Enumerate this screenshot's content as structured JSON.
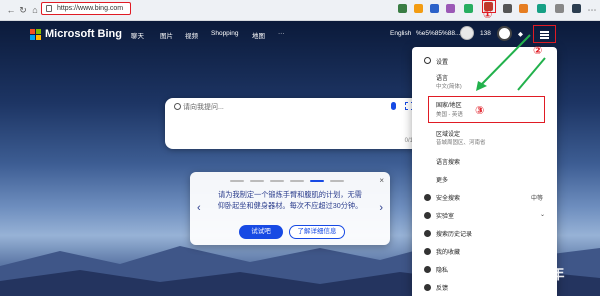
{
  "browser": {
    "url": "https://www.bing.com",
    "icons": [
      "back-icon",
      "reload-icon",
      "home-icon"
    ]
  },
  "annotations": {
    "step1": "①",
    "step2": "②",
    "step3": "③"
  },
  "bing": {
    "logo": "Microsoft Bing",
    "nav": [
      "聊天",
      "图片",
      "视频",
      "Shopping",
      "地图",
      "···"
    ],
    "language_link": "English",
    "account_text": "%e5%85%88...",
    "points": "138",
    "search": {
      "placeholder": "请向我提问...",
      "counter": "0/1000"
    },
    "card": {
      "text": "请为我制定一个锻炼手臂和腹肌的计划，无需仰卧起坐和健身器材。每次不应超过30分钟。",
      "primary_button": "试试吧",
      "secondary_button": "了解详细信息",
      "close": "×",
      "prev": "‹",
      "next": "›"
    }
  },
  "settings_menu": {
    "title": "设置",
    "language_label": "语言",
    "language_value": "中文(简体)",
    "region_label": "国家/地区",
    "region_value": "美国 - 英语",
    "location_label": "区域设定",
    "location_value": "昔城周固区、河南省",
    "search_language": "语言搜索",
    "more": "更多",
    "safe_search": "安全搜索",
    "safe_search_value": "中等",
    "labs": "实验室",
    "history": "搜索历史记录",
    "saves": "我的收藏",
    "privacy": "隐私",
    "feedback": "反馈"
  },
  "watermark": "知乎 @流年",
  "colors": {
    "accent": "#174ae4",
    "annotation": "#e01b24",
    "arrow": "#22b14c"
  }
}
